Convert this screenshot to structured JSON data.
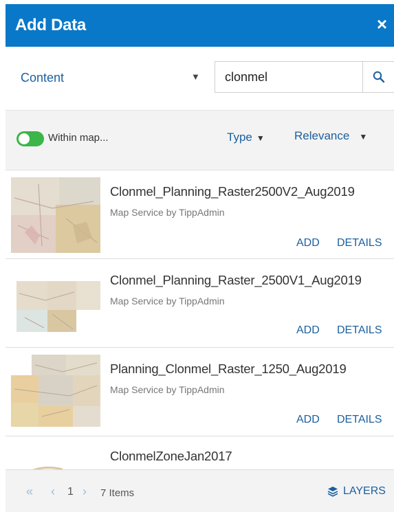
{
  "header": {
    "title": "Add Data",
    "close_symbol": "×"
  },
  "toolbar": {
    "content_label": "Content",
    "search_value": "clonmel"
  },
  "filters": {
    "within_map_label": "Within map...",
    "within_map_on": true,
    "type_label": "Type",
    "sort_label": "Relevance"
  },
  "results": [
    {
      "title": "Clonmel_Planning_Raster2500V2_Aug2019",
      "subtitle": "Map Service by TippAdmin",
      "add_label": "ADD",
      "details_label": "DETAILS"
    },
    {
      "title": "Clonmel_Planning_Raster_2500V1_Aug2019",
      "subtitle": "Map Service by TippAdmin",
      "add_label": "ADD",
      "details_label": "DETAILS"
    },
    {
      "title": "Planning_Clonmel_Raster_1250_Aug2019",
      "subtitle": "Map Service by TippAdmin",
      "add_label": "ADD",
      "details_label": "DETAILS"
    },
    {
      "title": "ClonmelZoneJan2017"
    }
  ],
  "footer": {
    "first_symbol": "«",
    "prev_symbol": "‹",
    "page": "1",
    "next_symbol": "›",
    "item_count": "7 Items",
    "layers_label": "LAYERS"
  },
  "colors": {
    "header": "#0a78c8",
    "accent": "#1b5f9e",
    "toggle_on": "#3cb54a"
  },
  "icons": [
    "close-icon",
    "dropdown-caret-icon",
    "search-icon",
    "toggle-switch",
    "layers-icon"
  ]
}
